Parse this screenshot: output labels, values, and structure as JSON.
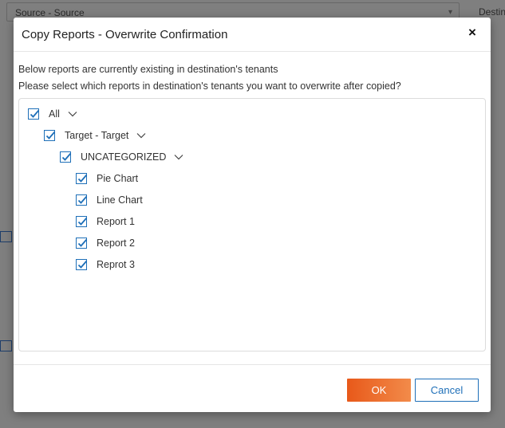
{
  "background": {
    "source_select": "Source - Source",
    "destination_label": "Destin"
  },
  "modal": {
    "title": "Copy Reports - Overwrite Confirmation",
    "close_label": "×",
    "message_line1": "Below reports are currently existing in destination's tenants",
    "message_line2": "Please select which reports in destination's tenants you want to overwrite after copied?",
    "tree": {
      "all": {
        "label": "All",
        "checked": true
      },
      "tenant": {
        "label": "Target - Target",
        "checked": true
      },
      "category": {
        "label": "UNCATEGORIZED",
        "checked": true
      },
      "reports": [
        {
          "label": "Pie Chart",
          "checked": true
        },
        {
          "label": "Line Chart",
          "checked": true
        },
        {
          "label": "Report 1",
          "checked": true
        },
        {
          "label": "Report 2",
          "checked": true
        },
        {
          "label": "Reprot 3",
          "checked": true
        }
      ]
    },
    "ok_label": "OK",
    "cancel_label": "Cancel"
  },
  "colors": {
    "accent": "#1e6fb8",
    "ok_button": "#e8591a"
  }
}
